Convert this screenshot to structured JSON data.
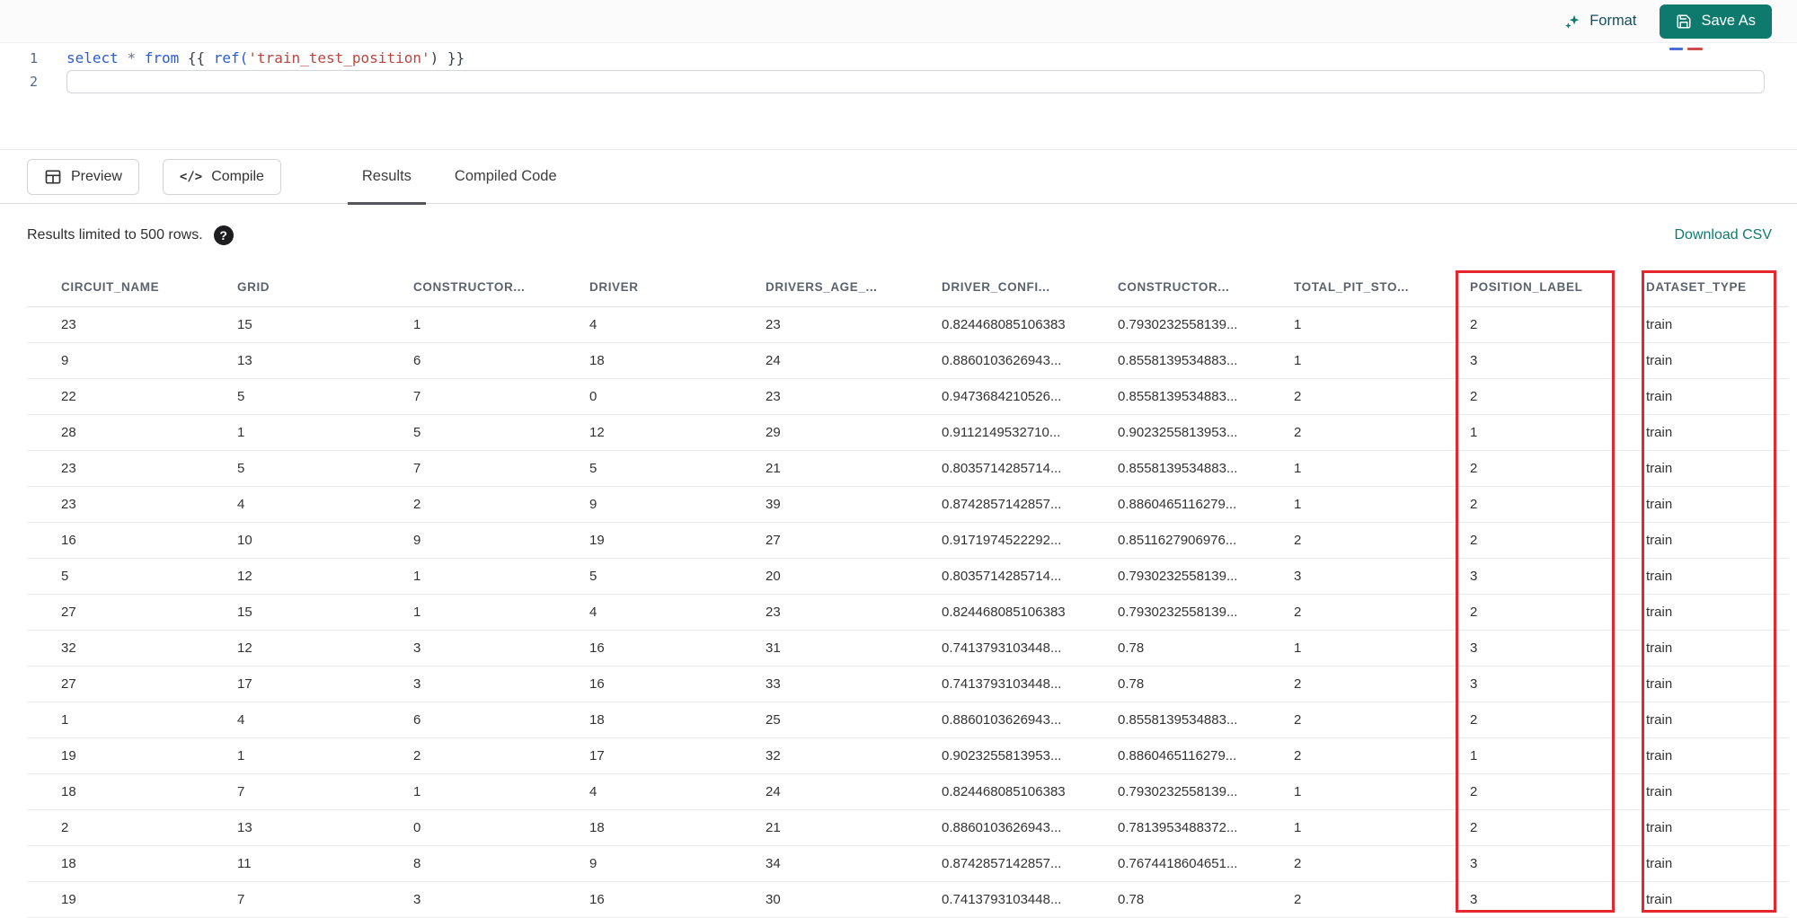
{
  "colors": {
    "accent_teal": "#0e7a6e",
    "annotation_red": "#e8262d"
  },
  "editor": {
    "toolbar": {
      "format_label": "Format",
      "save_as_label": "Save As"
    },
    "code": {
      "line_numbers": [
        "1",
        "2"
      ],
      "tokens": [
        {
          "t": "select",
          "c": "kw"
        },
        {
          "t": " ",
          "c": "plain"
        },
        {
          "t": "*",
          "c": "op"
        },
        {
          "t": " ",
          "c": "plain"
        },
        {
          "t": "from",
          "c": "kw"
        },
        {
          "t": " {{ ",
          "c": "plain"
        },
        {
          "t": "ref(",
          "c": "fn"
        },
        {
          "t": "'train_test_position'",
          "c": "str"
        },
        {
          "t": ") }}",
          "c": "plain"
        }
      ]
    }
  },
  "results_panel": {
    "preview_label": "Preview",
    "compile_label": "Compile",
    "compile_icon_glyph": "</>",
    "tabs": [
      {
        "label": "Results",
        "active": true
      },
      {
        "label": "Compiled Code",
        "active": false
      }
    ],
    "info": "Results limited to 500 rows.",
    "help_glyph": "?",
    "download_csv": "Download CSV"
  },
  "table": {
    "columns": [
      "CIRCUIT_NAME",
      "GRID",
      "CONSTRUCTOR...",
      "DRIVER",
      "DRIVERS_AGE_...",
      "DRIVER_CONFI...",
      "CONSTRUCTOR...",
      "TOTAL_PIT_STO...",
      "POSITION_LABEL",
      "DATASET_TYPE"
    ],
    "rows": [
      [
        "23",
        "15",
        "1",
        "4",
        "23",
        "0.824468085106383",
        "0.7930232558139...",
        "1",
        "2",
        "train"
      ],
      [
        "9",
        "13",
        "6",
        "18",
        "24",
        "0.8860103626943...",
        "0.8558139534883...",
        "1",
        "3",
        "train"
      ],
      [
        "22",
        "5",
        "7",
        "0",
        "23",
        "0.9473684210526...",
        "0.8558139534883...",
        "2",
        "2",
        "train"
      ],
      [
        "28",
        "1",
        "5",
        "12",
        "29",
        "0.9112149532710...",
        "0.9023255813953...",
        "2",
        "1",
        "train"
      ],
      [
        "23",
        "5",
        "7",
        "5",
        "21",
        "0.8035714285714...",
        "0.8558139534883...",
        "1",
        "2",
        "train"
      ],
      [
        "23",
        "4",
        "2",
        "9",
        "39",
        "0.8742857142857...",
        "0.8860465116279...",
        "1",
        "2",
        "train"
      ],
      [
        "16",
        "10",
        "9",
        "19",
        "27",
        "0.9171974522292...",
        "0.8511627906976...",
        "2",
        "2",
        "train"
      ],
      [
        "5",
        "12",
        "1",
        "5",
        "20",
        "0.8035714285714...",
        "0.7930232558139...",
        "3",
        "3",
        "train"
      ],
      [
        "27",
        "15",
        "1",
        "4",
        "23",
        "0.824468085106383",
        "0.7930232558139...",
        "2",
        "2",
        "train"
      ],
      [
        "32",
        "12",
        "3",
        "16",
        "31",
        "0.7413793103448...",
        "0.78",
        "1",
        "3",
        "train"
      ],
      [
        "27",
        "17",
        "3",
        "16",
        "33",
        "0.7413793103448...",
        "0.78",
        "2",
        "3",
        "train"
      ],
      [
        "1",
        "4",
        "6",
        "18",
        "25",
        "0.8860103626943...",
        "0.8558139534883...",
        "2",
        "2",
        "train"
      ],
      [
        "19",
        "1",
        "2",
        "17",
        "32",
        "0.9023255813953...",
        "0.8860465116279...",
        "2",
        "1",
        "train"
      ],
      [
        "18",
        "7",
        "1",
        "4",
        "24",
        "0.824468085106383",
        "0.7930232558139...",
        "1",
        "2",
        "train"
      ],
      [
        "2",
        "13",
        "0",
        "18",
        "21",
        "0.8860103626943...",
        "0.7813953488372...",
        "1",
        "2",
        "train"
      ],
      [
        "18",
        "11",
        "8",
        "9",
        "34",
        "0.8742857142857...",
        "0.7674418604651...",
        "2",
        "3",
        "train"
      ],
      [
        "19",
        "7",
        "3",
        "16",
        "30",
        "0.7413793103448...",
        "0.78",
        "2",
        "3",
        "train"
      ]
    ]
  }
}
